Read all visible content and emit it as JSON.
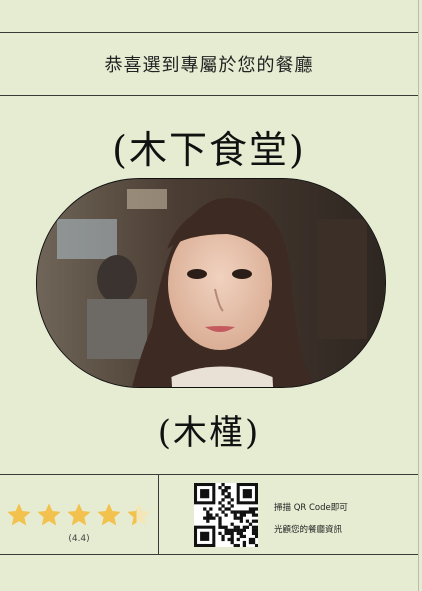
{
  "headline": "恭喜選到專屬於您的餐廳",
  "restaurant_name": "(木下食堂)",
  "staff_name": "(木槿)",
  "rating": {
    "value": 4.4,
    "label": "(4.4)",
    "max": 5,
    "star_color": "#f2c14e"
  },
  "qr": {
    "line1": "掃描 QR Code即可",
    "line2": "光顧您的餐廳資訊"
  },
  "colors": {
    "background": "#e6ecd2",
    "rule": "#3a3a3a"
  }
}
